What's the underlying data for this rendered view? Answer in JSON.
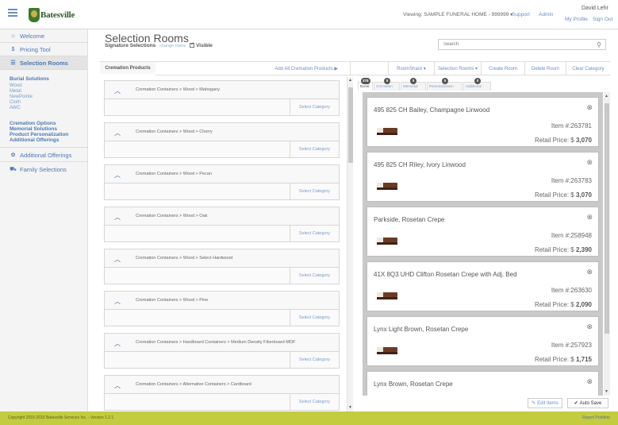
{
  "header": {
    "logo_text": "Batesville",
    "viewing": "Viewing: SAMPLE FUNERAL HOME - 999999",
    "support": "Support",
    "admin": "Admin",
    "user_name": "David Lehr",
    "my_profile": "My Profile",
    "sign_out": "Sign Out"
  },
  "sidebar": {
    "welcome": "Welcome",
    "pricing_tool": "Pricing Tool",
    "selection_rooms": "Selection Rooms",
    "burial_solutions": "Burial Solutions",
    "burial_items": [
      "Wood",
      "Metal",
      "NewPointe",
      "Cloth",
      "AWC"
    ],
    "cremation_options": "Cremation Options",
    "memorial_solutions": "Memorial Solutions",
    "product_personalization": "Product Personalization",
    "additional_offerings_sub": "Additional Offerings",
    "additional_offerings": "Additional Offerings",
    "family_selections": "Family Selections"
  },
  "main": {
    "title": "Selection Rooms",
    "signature_label": "Signature Selections",
    "change_name": "change name",
    "visible_label": "Visible",
    "search_placeholder": "Search"
  },
  "toolbar": {
    "cremation_products": "Cremation Products",
    "add_all": "Add All Cremation Products ▶",
    "roomshare": "RoomShare ▾",
    "selection_rooms": "Selection Rooms ▾",
    "create_room": "Create Room",
    "delete_room": "Delete Room",
    "clear_category": "Clear Category"
  },
  "categories": [
    {
      "path": "Cremation Containers > Wood > Mahogany",
      "action": "Select Category"
    },
    {
      "path": "Cremation Containers > Wood > Cherry",
      "action": "Select Category"
    },
    {
      "path": "Cremation Containers > Wood > Pecan",
      "action": "Select Category"
    },
    {
      "path": "Cremation Containers > Wood > Oak",
      "action": "Select Category"
    },
    {
      "path": "Cremation Containers > Wood > Select Hardwood",
      "action": "Select Category"
    },
    {
      "path": "Cremation Containers > Wood > Pine",
      "action": "Select Category"
    },
    {
      "path": "Cremation Containers > Hardboard Containers > Medium Density Fiberboard-MDF",
      "action": "Select Category"
    },
    {
      "path": "Cremation Containers > Alternative Containers > Cardboard",
      "action": "Select Category"
    }
  ],
  "cart_tabs": [
    {
      "label": "Burial",
      "count": "378"
    },
    {
      "label": "Cremation",
      "count": "0"
    },
    {
      "label": "Memorial",
      "count": "0"
    },
    {
      "label": "Personalization",
      "count": "0"
    },
    {
      "label": "Additional",
      "count": "0"
    }
  ],
  "cart_items": [
    {
      "name": "495 825 CH Bailey, Champagne Linwood",
      "item_no": "Item #:263781",
      "price_label": "Retail Price: $",
      "price": "3,070"
    },
    {
      "name": "495 825 CH Riley, Ivory Linwood",
      "item_no": "Item #:263783",
      "price_label": "Retail Price: $",
      "price": "3,070"
    },
    {
      "name": "Parkside, Rosetan Crepe",
      "item_no": "Item #:258948",
      "price_label": "Retail Price: $",
      "price": "2,390"
    },
    {
      "name": "41X 8Q3 UHD Clifton Rosetan Crepe with Adj. Bed",
      "item_no": "Item #:263630",
      "price_label": "Retail Price: $",
      "price": "2,090"
    },
    {
      "name": "Lynx Light Brown, Rosetan Crepe",
      "item_no": "Item #:257923",
      "price_label": "Retail Price: $",
      "price": "1,715"
    },
    {
      "name": "Lynx Brown, Rosetan Crepe",
      "item_no": "",
      "price_label": "",
      "price": ""
    }
  ],
  "cart_footer": {
    "edit_items": "Edit Items",
    "auto_save": "Auto Save"
  },
  "footer": {
    "copyright": "Copyright 2015-2016 Batesville Services Inc. - Version 1.2.1",
    "report": "Report Problem"
  },
  "colors": {
    "link": "#6a8fbf",
    "footer_bar": "#c2cc3e",
    "brand_green": "#2d5a24"
  }
}
